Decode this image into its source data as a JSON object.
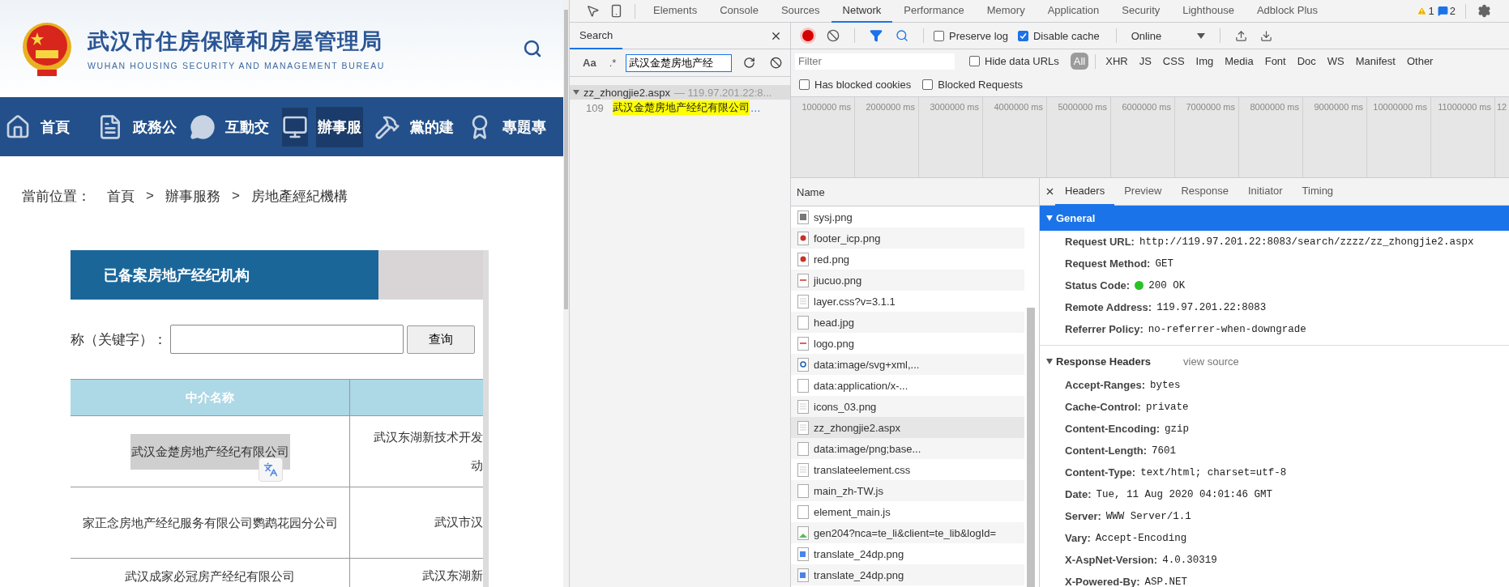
{
  "site": {
    "title": "武汉市住房保障和房屋管理局",
    "subtitle": "WUHAN HOUSING SECURITY AND MANAGEMENT BUREAU",
    "nav": [
      {
        "label": "首頁",
        "kind": "home",
        "selected": false
      },
      {
        "label": "政務公",
        "kind": "document",
        "selected": false
      },
      {
        "label": "互動交",
        "kind": "chat",
        "selected": false
      },
      {
        "label": "辦事服",
        "kind": "monitor",
        "selected": true
      },
      {
        "label": "黨的建",
        "kind": "hammer",
        "selected": false
      },
      {
        "label": "專題專",
        "kind": "award",
        "selected": false
      }
    ],
    "breadcrumb": {
      "label": "當前位置：",
      "items": [
        "首頁",
        "辦事服務",
        "房地產經紀機構"
      ],
      "separator": ">"
    },
    "card": {
      "title": "已备案房地产经纪机构",
      "search_label": "称（关键字）：",
      "search_button": "查询",
      "columns": [
        "中介名称"
      ],
      "rows": [
        {
          "name": "武汉金楚房地产经纪有限公司",
          "highlighted": true,
          "address_lines": [
            "武汉东湖新技术开发",
            "动"
          ]
        },
        {
          "name": "家正念房地产经纪服务有限公司鹦鹉花园分公司",
          "highlighted": false,
          "address_lines": [
            "武汉市汉"
          ]
        },
        {
          "name": "武汉成家必冠房产经纪有限公司",
          "highlighted": false,
          "address_lines": [
            "武汉东湖新"
          ]
        }
      ]
    }
  },
  "devtools": {
    "tabs": [
      {
        "label": "Elements",
        "selected": false
      },
      {
        "label": "Console",
        "selected": false
      },
      {
        "label": "Sources",
        "selected": false
      },
      {
        "label": "Network",
        "selected": true
      },
      {
        "label": "Performance",
        "selected": false
      },
      {
        "label": "Memory",
        "selected": false
      },
      {
        "label": "Application",
        "selected": false
      },
      {
        "label": "Security",
        "selected": false
      },
      {
        "label": "Lighthouse",
        "selected": false
      },
      {
        "label": "Adblock Plus",
        "selected": false
      }
    ],
    "warnings": "1",
    "messages": "2",
    "search_panel": {
      "tab": "Search",
      "case_label": "Aa",
      "regex_label": ".*",
      "query": "武汉金楚房地产经",
      "results": [
        {
          "file": "zz_zhongjie2.aspx",
          "host": "— 119.97.201.22:8...",
          "expanded": true,
          "matches": [
            {
              "line": "109",
              "text": "武汉金楚房地产经纪有限公司",
              "more": "…"
            }
          ]
        }
      ]
    },
    "network": {
      "preserve_log": {
        "label": "Preserve log",
        "checked": false
      },
      "disable_cache": {
        "label": "Disable cache",
        "checked": true
      },
      "throttle": "Online",
      "filter_placeholder": "Filter",
      "hide_data_urls": {
        "label": "Hide data URLs",
        "checked": false
      },
      "types": [
        {
          "label": "All",
          "selected": true
        },
        {
          "label": "XHR",
          "selected": false
        },
        {
          "label": "JS",
          "selected": false
        },
        {
          "label": "CSS",
          "selected": false
        },
        {
          "label": "Img",
          "selected": false
        },
        {
          "label": "Media",
          "selected": false
        },
        {
          "label": "Font",
          "selected": false
        },
        {
          "label": "Doc",
          "selected": false
        },
        {
          "label": "WS",
          "selected": false
        },
        {
          "label": "Manifest",
          "selected": false
        },
        {
          "label": "Other",
          "selected": false
        }
      ],
      "blocked_cookies": {
        "label": "Has blocked cookies",
        "checked": false
      },
      "blocked_requests": {
        "label": "Blocked Requests",
        "checked": false
      },
      "timeline_ticks": [
        "1000000 ms",
        "2000000 ms",
        "3000000 ms",
        "4000000 ms",
        "5000000 ms",
        "6000000 ms",
        "7000000 ms",
        "8000000 ms",
        "9000000 ms",
        "10000000 ms",
        "11000000 ms",
        "12"
      ],
      "name_column": "Name",
      "requests": [
        {
          "name": "sysj.png",
          "kind": "qr",
          "selected": false
        },
        {
          "name": "footer_icp.png",
          "kind": "badge",
          "selected": false
        },
        {
          "name": "red.png",
          "kind": "badge",
          "selected": false
        },
        {
          "name": "jiucuo.png",
          "kind": "image",
          "selected": false
        },
        {
          "name": "layer.css?v=3.1.1",
          "kind": "doc",
          "selected": false
        },
        {
          "name": "head.jpg",
          "kind": "blank",
          "selected": false
        },
        {
          "name": "logo.png",
          "kind": "image",
          "selected": false
        },
        {
          "name": "data:image/svg+xml,...",
          "kind": "search",
          "selected": false
        },
        {
          "name": "data:application/x-...",
          "kind": "blank",
          "selected": false
        },
        {
          "name": "icons_03.png",
          "kind": "doc",
          "selected": false
        },
        {
          "name": "zz_zhongjie2.aspx",
          "kind": "doc",
          "selected": true
        },
        {
          "name": "data:image/png;base...",
          "kind": "blank",
          "selected": false
        },
        {
          "name": "translateelement.css",
          "kind": "doc",
          "selected": false
        },
        {
          "name": "main_zh-TW.js",
          "kind": "blank",
          "selected": false
        },
        {
          "name": "element_main.js",
          "kind": "blank",
          "selected": false
        },
        {
          "name": "gen204?nca=te_li&client=te_lib&logId=",
          "kind": "picture",
          "selected": false
        },
        {
          "name": "translate_24dp.png",
          "kind": "translate",
          "selected": false
        },
        {
          "name": "translate_24dp.png",
          "kind": "translate",
          "selected": false
        }
      ],
      "detail": {
        "tabs": [
          {
            "label": "Headers",
            "selected": true
          },
          {
            "label": "Preview",
            "selected": false
          },
          {
            "label": "Response",
            "selected": false
          },
          {
            "label": "Initiator",
            "selected": false
          },
          {
            "label": "Timing",
            "selected": false
          }
        ],
        "sections": [
          {
            "title": "General",
            "expanded": true,
            "highlighted": true,
            "rows": [
              {
                "key": "Request URL:",
                "value": "http://119.97.201.22:8083/search/zzzz/zz_zhongjie2.aspx"
              },
              {
                "key": "Request Method:",
                "value": "GET"
              },
              {
                "key": "Status Code:",
                "value": "200 OK",
                "kind": "status"
              },
              {
                "key": "Remote Address:",
                "value": "119.97.201.22:8083"
              },
              {
                "key": "Referrer Policy:",
                "value": "no-referrer-when-downgrade"
              }
            ]
          },
          {
            "title": "Response Headers",
            "expanded": true,
            "highlighted": false,
            "link": "view source",
            "rows": [
              {
                "key": "Accept-Ranges:",
                "value": "bytes"
              },
              {
                "key": "Cache-Control:",
                "value": "private"
              },
              {
                "key": "Content-Encoding:",
                "value": "gzip"
              },
              {
                "key": "Content-Length:",
                "value": "7601"
              },
              {
                "key": "Content-Type:",
                "value": "text/html; charset=utf-8"
              },
              {
                "key": "Date:",
                "value": "Tue, 11 Aug 2020 04:01:46 GMT"
              },
              {
                "key": "Server:",
                "value": "WWW Server/1.1"
              },
              {
                "key": "Vary:",
                "value": "Accept-Encoding"
              },
              {
                "key": "X-AspNet-Version:",
                "value": "4.0.30319"
              },
              {
                "key": "X-Powered-By:",
                "value": "ASP.NET"
              }
            ]
          }
        ]
      }
    }
  }
}
